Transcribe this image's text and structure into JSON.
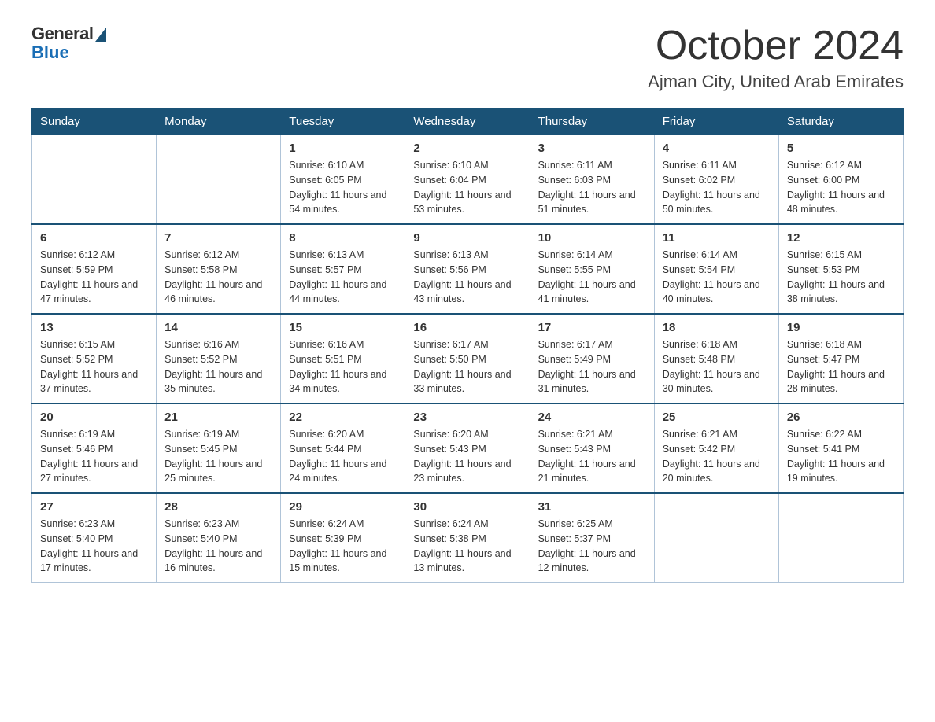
{
  "logo": {
    "general": "General",
    "blue": "Blue"
  },
  "title": "October 2024",
  "subtitle": "Ajman City, United Arab Emirates",
  "days_of_week": [
    "Sunday",
    "Monday",
    "Tuesday",
    "Wednesday",
    "Thursday",
    "Friday",
    "Saturday"
  ],
  "weeks": [
    [
      {
        "day": "",
        "sunrise": "",
        "sunset": "",
        "daylight": ""
      },
      {
        "day": "",
        "sunrise": "",
        "sunset": "",
        "daylight": ""
      },
      {
        "day": "1",
        "sunrise": "Sunrise: 6:10 AM",
        "sunset": "Sunset: 6:05 PM",
        "daylight": "Daylight: 11 hours and 54 minutes."
      },
      {
        "day": "2",
        "sunrise": "Sunrise: 6:10 AM",
        "sunset": "Sunset: 6:04 PM",
        "daylight": "Daylight: 11 hours and 53 minutes."
      },
      {
        "day": "3",
        "sunrise": "Sunrise: 6:11 AM",
        "sunset": "Sunset: 6:03 PM",
        "daylight": "Daylight: 11 hours and 51 minutes."
      },
      {
        "day": "4",
        "sunrise": "Sunrise: 6:11 AM",
        "sunset": "Sunset: 6:02 PM",
        "daylight": "Daylight: 11 hours and 50 minutes."
      },
      {
        "day": "5",
        "sunrise": "Sunrise: 6:12 AM",
        "sunset": "Sunset: 6:00 PM",
        "daylight": "Daylight: 11 hours and 48 minutes."
      }
    ],
    [
      {
        "day": "6",
        "sunrise": "Sunrise: 6:12 AM",
        "sunset": "Sunset: 5:59 PM",
        "daylight": "Daylight: 11 hours and 47 minutes."
      },
      {
        "day": "7",
        "sunrise": "Sunrise: 6:12 AM",
        "sunset": "Sunset: 5:58 PM",
        "daylight": "Daylight: 11 hours and 46 minutes."
      },
      {
        "day": "8",
        "sunrise": "Sunrise: 6:13 AM",
        "sunset": "Sunset: 5:57 PM",
        "daylight": "Daylight: 11 hours and 44 minutes."
      },
      {
        "day": "9",
        "sunrise": "Sunrise: 6:13 AM",
        "sunset": "Sunset: 5:56 PM",
        "daylight": "Daylight: 11 hours and 43 minutes."
      },
      {
        "day": "10",
        "sunrise": "Sunrise: 6:14 AM",
        "sunset": "Sunset: 5:55 PM",
        "daylight": "Daylight: 11 hours and 41 minutes."
      },
      {
        "day": "11",
        "sunrise": "Sunrise: 6:14 AM",
        "sunset": "Sunset: 5:54 PM",
        "daylight": "Daylight: 11 hours and 40 minutes."
      },
      {
        "day": "12",
        "sunrise": "Sunrise: 6:15 AM",
        "sunset": "Sunset: 5:53 PM",
        "daylight": "Daylight: 11 hours and 38 minutes."
      }
    ],
    [
      {
        "day": "13",
        "sunrise": "Sunrise: 6:15 AM",
        "sunset": "Sunset: 5:52 PM",
        "daylight": "Daylight: 11 hours and 37 minutes."
      },
      {
        "day": "14",
        "sunrise": "Sunrise: 6:16 AM",
        "sunset": "Sunset: 5:52 PM",
        "daylight": "Daylight: 11 hours and 35 minutes."
      },
      {
        "day": "15",
        "sunrise": "Sunrise: 6:16 AM",
        "sunset": "Sunset: 5:51 PM",
        "daylight": "Daylight: 11 hours and 34 minutes."
      },
      {
        "day": "16",
        "sunrise": "Sunrise: 6:17 AM",
        "sunset": "Sunset: 5:50 PM",
        "daylight": "Daylight: 11 hours and 33 minutes."
      },
      {
        "day": "17",
        "sunrise": "Sunrise: 6:17 AM",
        "sunset": "Sunset: 5:49 PM",
        "daylight": "Daylight: 11 hours and 31 minutes."
      },
      {
        "day": "18",
        "sunrise": "Sunrise: 6:18 AM",
        "sunset": "Sunset: 5:48 PM",
        "daylight": "Daylight: 11 hours and 30 minutes."
      },
      {
        "day": "19",
        "sunrise": "Sunrise: 6:18 AM",
        "sunset": "Sunset: 5:47 PM",
        "daylight": "Daylight: 11 hours and 28 minutes."
      }
    ],
    [
      {
        "day": "20",
        "sunrise": "Sunrise: 6:19 AM",
        "sunset": "Sunset: 5:46 PM",
        "daylight": "Daylight: 11 hours and 27 minutes."
      },
      {
        "day": "21",
        "sunrise": "Sunrise: 6:19 AM",
        "sunset": "Sunset: 5:45 PM",
        "daylight": "Daylight: 11 hours and 25 minutes."
      },
      {
        "day": "22",
        "sunrise": "Sunrise: 6:20 AM",
        "sunset": "Sunset: 5:44 PM",
        "daylight": "Daylight: 11 hours and 24 minutes."
      },
      {
        "day": "23",
        "sunrise": "Sunrise: 6:20 AM",
        "sunset": "Sunset: 5:43 PM",
        "daylight": "Daylight: 11 hours and 23 minutes."
      },
      {
        "day": "24",
        "sunrise": "Sunrise: 6:21 AM",
        "sunset": "Sunset: 5:43 PM",
        "daylight": "Daylight: 11 hours and 21 minutes."
      },
      {
        "day": "25",
        "sunrise": "Sunrise: 6:21 AM",
        "sunset": "Sunset: 5:42 PM",
        "daylight": "Daylight: 11 hours and 20 minutes."
      },
      {
        "day": "26",
        "sunrise": "Sunrise: 6:22 AM",
        "sunset": "Sunset: 5:41 PM",
        "daylight": "Daylight: 11 hours and 19 minutes."
      }
    ],
    [
      {
        "day": "27",
        "sunrise": "Sunrise: 6:23 AM",
        "sunset": "Sunset: 5:40 PM",
        "daylight": "Daylight: 11 hours and 17 minutes."
      },
      {
        "day": "28",
        "sunrise": "Sunrise: 6:23 AM",
        "sunset": "Sunset: 5:40 PM",
        "daylight": "Daylight: 11 hours and 16 minutes."
      },
      {
        "day": "29",
        "sunrise": "Sunrise: 6:24 AM",
        "sunset": "Sunset: 5:39 PM",
        "daylight": "Daylight: 11 hours and 15 minutes."
      },
      {
        "day": "30",
        "sunrise": "Sunrise: 6:24 AM",
        "sunset": "Sunset: 5:38 PM",
        "daylight": "Daylight: 11 hours and 13 minutes."
      },
      {
        "day": "31",
        "sunrise": "Sunrise: 6:25 AM",
        "sunset": "Sunset: 5:37 PM",
        "daylight": "Daylight: 11 hours and 12 minutes."
      },
      {
        "day": "",
        "sunrise": "",
        "sunset": "",
        "daylight": ""
      },
      {
        "day": "",
        "sunrise": "",
        "sunset": "",
        "daylight": ""
      }
    ]
  ]
}
